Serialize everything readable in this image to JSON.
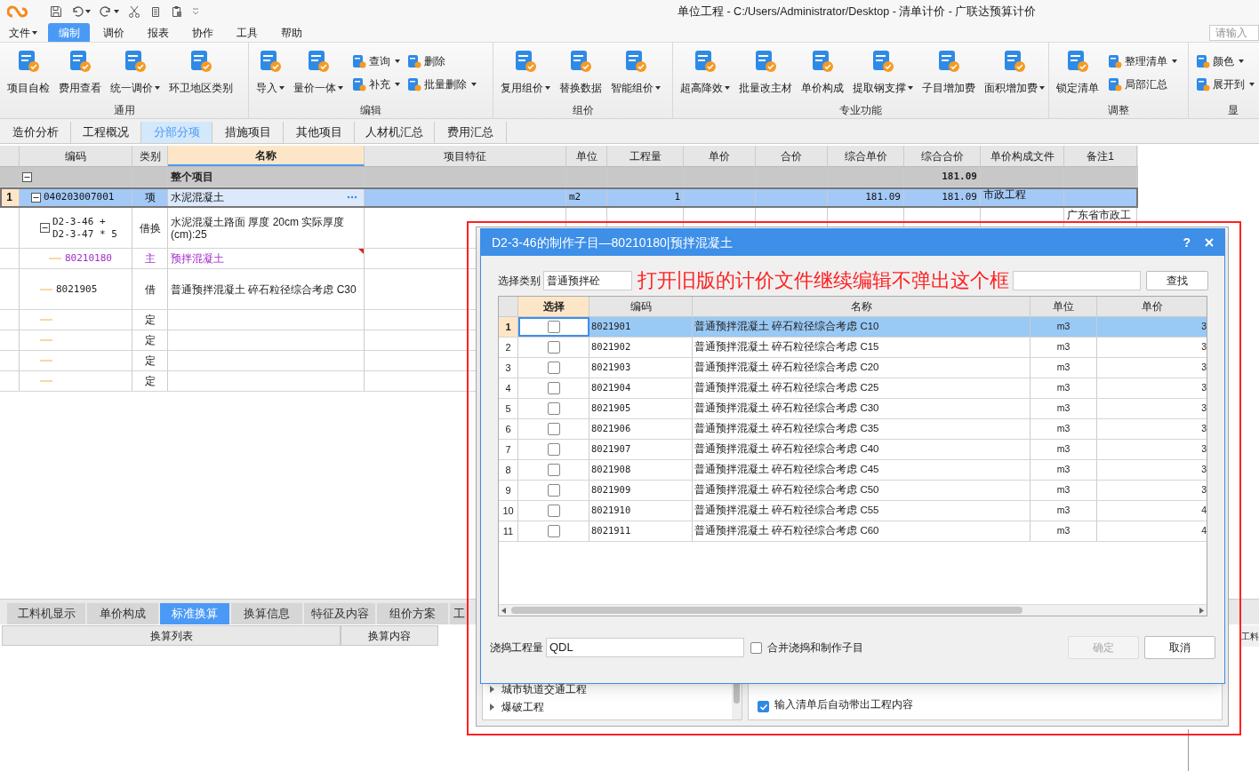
{
  "app": {
    "title": "单位工程 - C:/Users/Administrator/Desktop - 清单计价 - 广联达预算计价"
  },
  "menu": [
    {
      "label": "文件",
      "selected": false,
      "dropdown": true
    },
    {
      "label": "编制",
      "selected": true,
      "dropdown": false
    },
    {
      "label": "调价",
      "selected": false,
      "dropdown": false
    },
    {
      "label": "报表",
      "selected": false,
      "dropdown": false
    },
    {
      "label": "协作",
      "selected": false,
      "dropdown": false
    },
    {
      "label": "工具",
      "selected": false,
      "dropdown": false
    },
    {
      "label": "帮助",
      "selected": false,
      "dropdown": false
    }
  ],
  "search": {
    "placeholder": "请输入"
  },
  "ribbon": [
    {
      "label": "通用",
      "items": [
        {
          "label": "项目自检",
          "kind": "large",
          "dropdown": false
        },
        {
          "label": "费用查看",
          "kind": "large",
          "dropdown": false
        },
        {
          "label": "统一调价",
          "kind": "large",
          "dropdown": true
        },
        {
          "label": "环卫地区类别",
          "kind": "large",
          "dropdown": false
        }
      ]
    },
    {
      "label": "编辑",
      "items": [
        {
          "label": "导入",
          "kind": "large",
          "dropdown": true
        },
        {
          "label": "量价一体",
          "kind": "large",
          "dropdown": true
        },
        {
          "label": "查询",
          "kind": "small",
          "dropdown": true
        },
        {
          "label": "补充",
          "kind": "small",
          "dropdown": true
        },
        {
          "label": "删除",
          "kind": "small",
          "dropdown": false
        },
        {
          "label": "批量删除",
          "kind": "small",
          "dropdown": true
        }
      ]
    },
    {
      "label": "组价",
      "items": [
        {
          "label": "复用组价",
          "kind": "large",
          "dropdown": true
        },
        {
          "label": "替换数据",
          "kind": "large",
          "dropdown": false
        },
        {
          "label": "智能组价",
          "kind": "large",
          "dropdown": true
        }
      ]
    },
    {
      "label": "专业功能",
      "items": [
        {
          "label": "超高降效",
          "kind": "large",
          "dropdown": true
        },
        {
          "label": "批量改主材",
          "kind": "large",
          "dropdown": false
        },
        {
          "label": "单价构成",
          "kind": "large",
          "dropdown": false
        },
        {
          "label": "提取钢支撑",
          "kind": "large",
          "dropdown": true
        },
        {
          "label": "子目增加费",
          "kind": "large",
          "dropdown": false
        },
        {
          "label": "面积增加费",
          "kind": "large",
          "dropdown": true
        }
      ]
    },
    {
      "label": "调整",
      "items": [
        {
          "label": "锁定清单",
          "kind": "large",
          "dropdown": false
        },
        {
          "label": "整理清单",
          "kind": "small",
          "dropdown": true
        },
        {
          "label": "局部汇总",
          "kind": "small",
          "dropdown": false
        }
      ]
    },
    {
      "label": "显",
      "items": [
        {
          "label": "颜色",
          "kind": "small",
          "dropdown": true
        },
        {
          "label": "展开到",
          "kind": "small",
          "dropdown": true
        }
      ]
    }
  ],
  "view_tabs": [
    {
      "label": "造价分析",
      "selected": false
    },
    {
      "label": "工程概况",
      "selected": false
    },
    {
      "label": "分部分项",
      "selected": true
    },
    {
      "label": "措施项目",
      "selected": false
    },
    {
      "label": "其他项目",
      "selected": false
    },
    {
      "label": "人材机汇总",
      "selected": false
    },
    {
      "label": "费用汇总",
      "selected": false
    }
  ],
  "grid": {
    "columns": [
      "编码",
      "类别",
      "名称",
      "项目特征",
      "单位",
      "工程量",
      "单价",
      "合价",
      "综合单价",
      "综合合价",
      "单价构成文件",
      "备注1"
    ],
    "rows": [
      {
        "kind": "group",
        "name": "整个项目",
        "comp_amount": "181.09",
        "expanded": true,
        "children": [
          {
            "kind": "item",
            "num": "1",
            "code": "040203007001",
            "type": "项",
            "name": "水泥混凝土",
            "unit": "m2",
            "quantity": "1",
            "comp_price": "181.09",
            "comp_amount": "181.09",
            "price_file": "市政工程",
            "selected": true,
            "expanded": true,
            "children": [
              {
                "kind": "replaced",
                "code": "D2-3-46 +\nD2-3-47 * 5",
                "type": "借换",
                "name": "水泥混凝土路面 厚度 20cm  实际厚度\n(cm):25",
                "note": "广东省市政工",
                "expanded": true,
                "children": [
                  {
                    "kind": "main",
                    "code": "80210180",
                    "type": "主",
                    "name": "预拌混凝土"
                  }
                ]
              },
              {
                "kind": "borrowed",
                "code": "8021905",
                "type": "借",
                "name": "普通预拌混凝土 碎石粒径综合考虑 C30"
              },
              {
                "kind": "quota",
                "type": "定"
              },
              {
                "kind": "quota",
                "type": "定"
              },
              {
                "kind": "quota",
                "type": "定"
              },
              {
                "kind": "quota",
                "type": "定"
              }
            ]
          }
        ]
      }
    ]
  },
  "bottom_panel": {
    "tabs": [
      {
        "label": "工料机显示",
        "selected": false
      },
      {
        "label": "单价构成",
        "selected": false
      },
      {
        "label": "标准换算",
        "selected": true
      },
      {
        "label": "换算信息",
        "selected": false
      },
      {
        "label": "特征及内容",
        "selected": false
      },
      {
        "label": "组价方案",
        "selected": false
      },
      {
        "label": "工",
        "selected": false
      }
    ],
    "columns": [
      "换算列表",
      "换算内容"
    ],
    "right_tab": "工料"
  },
  "back_dialog": {
    "tree": [
      "城市轨道交通工程",
      "爆破工程"
    ],
    "option": {
      "label": "输入清单后自动带出工程内容",
      "checked": true
    }
  },
  "dialog": {
    "title": "D2-3-46的制作子目—80210180|预拌混凝土",
    "help": "?",
    "category_label": "选择类别",
    "category": "普通预拌砼",
    "search_button": "查找",
    "columns": [
      "选择",
      "编码",
      "名称",
      "单位",
      "单价"
    ],
    "rows": [
      {
        "num": "1",
        "selected": true,
        "checked": false,
        "code": "8021901",
        "name": "普通预拌混凝土 碎石粒径综合考虑 C10",
        "unit": "m3",
        "price": "3"
      },
      {
        "num": "2",
        "selected": false,
        "checked": false,
        "code": "8021902",
        "name": "普通预拌混凝土 碎石粒径综合考虑 C15",
        "unit": "m3",
        "price": "3"
      },
      {
        "num": "3",
        "selected": false,
        "checked": false,
        "code": "8021903",
        "name": "普通预拌混凝土 碎石粒径综合考虑 C20",
        "unit": "m3",
        "price": "3"
      },
      {
        "num": "4",
        "selected": false,
        "checked": false,
        "code": "8021904",
        "name": "普通预拌混凝土 碎石粒径综合考虑 C25",
        "unit": "m3",
        "price": "3"
      },
      {
        "num": "5",
        "selected": false,
        "checked": false,
        "code": "8021905",
        "name": "普通预拌混凝土 碎石粒径综合考虑 C30",
        "unit": "m3",
        "price": "3"
      },
      {
        "num": "6",
        "selected": false,
        "checked": false,
        "code": "8021906",
        "name": "普通预拌混凝土 碎石粒径综合考虑 C35",
        "unit": "m3",
        "price": "3"
      },
      {
        "num": "7",
        "selected": false,
        "checked": false,
        "code": "8021907",
        "name": "普通预拌混凝土 碎石粒径综合考虑 C40",
        "unit": "m3",
        "price": "3"
      },
      {
        "num": "8",
        "selected": false,
        "checked": false,
        "code": "8021908",
        "name": "普通预拌混凝土 碎石粒径综合考虑 C45",
        "unit": "m3",
        "price": "3"
      },
      {
        "num": "9",
        "selected": false,
        "checked": false,
        "code": "8021909",
        "name": "普通预拌混凝土 碎石粒径综合考虑 C50",
        "unit": "m3",
        "price": "3"
      },
      {
        "num": "10",
        "selected": false,
        "checked": false,
        "code": "8021910",
        "name": "普通预拌混凝土 碎石粒径综合考虑 C55",
        "unit": "m3",
        "price": "4"
      },
      {
        "num": "11",
        "selected": false,
        "checked": false,
        "code": "8021911",
        "name": "普通预拌混凝土 碎石粒径综合考虑 C60",
        "unit": "m3",
        "price": "4"
      }
    ],
    "qty_label": "浇捣工程量",
    "qty": "QDL",
    "merge": {
      "label": "合并浇捣和制作子目",
      "checked": false
    },
    "ok": {
      "label": "确定",
      "disabled": true
    },
    "cancel": "取消"
  },
  "annotation": {
    "text": "打开旧版的计价文件继续编辑不弹出这个框"
  }
}
